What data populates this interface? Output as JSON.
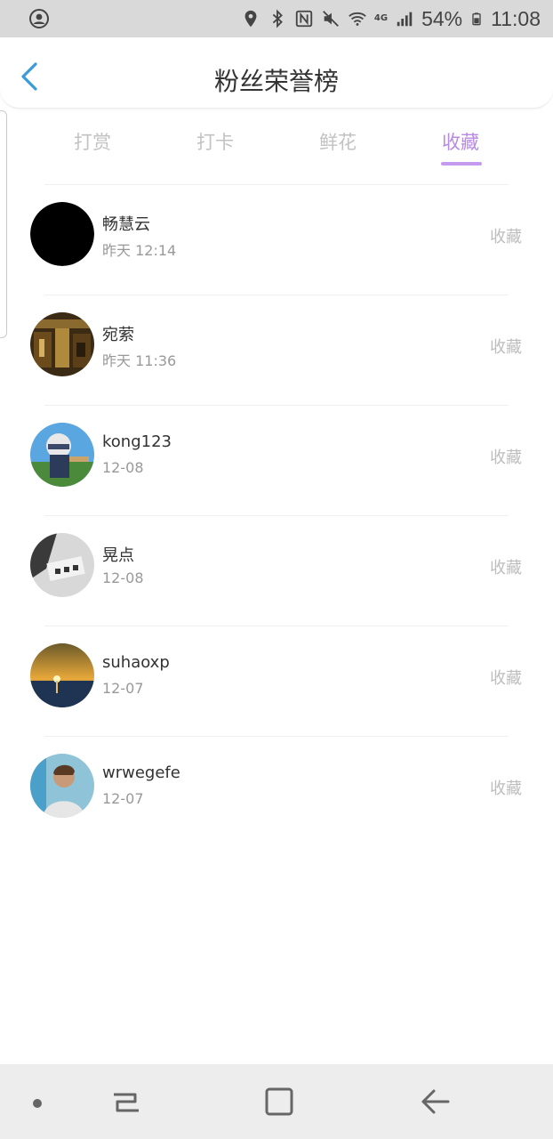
{
  "status_bar": {
    "network": "4G",
    "battery_percent": "54%",
    "time": "11:08"
  },
  "header": {
    "title": "粉丝荣誉榜"
  },
  "tabs": [
    {
      "label": "打赏",
      "active": false
    },
    {
      "label": "打卡",
      "active": false
    },
    {
      "label": "鲜花",
      "active": false
    },
    {
      "label": "收藏",
      "active": true
    }
  ],
  "list": [
    {
      "name": "畅慧云",
      "time": "昨天 12:14",
      "action": "收藏"
    },
    {
      "name": "宛萦",
      "time": "昨天 11:36",
      "action": "收藏"
    },
    {
      "name": "kong123",
      "time": "12-08",
      "action": "收藏"
    },
    {
      "name": "晃点",
      "time": "12-08",
      "action": "收藏"
    },
    {
      "name": "suhaoxp",
      "time": "12-07",
      "action": "收藏"
    },
    {
      "name": "wrwegefe",
      "time": "12-07",
      "action": "收藏"
    }
  ],
  "colors": {
    "accent": "#b78ae6",
    "back_arrow": "#3a9bdc"
  }
}
